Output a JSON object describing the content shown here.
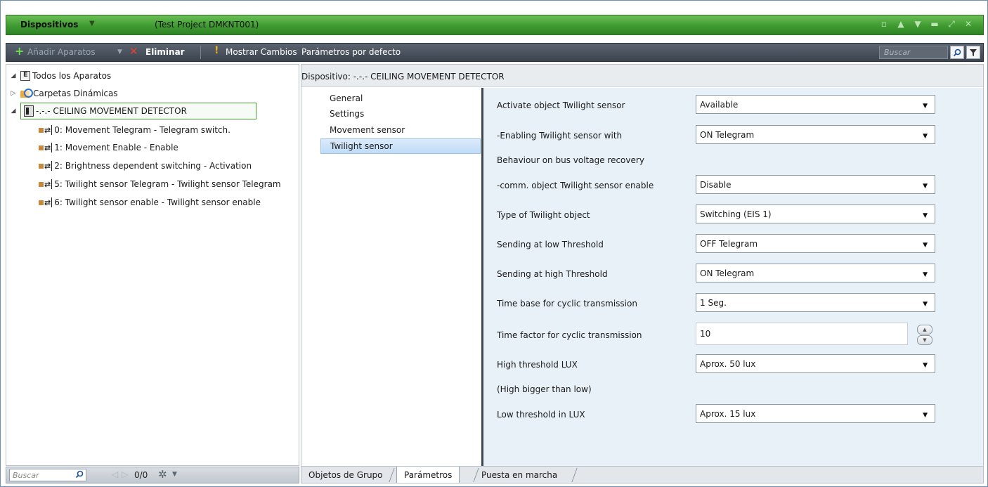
{
  "titlebar": {
    "title": "Dispositivos",
    "project": "(Test Project DMKNT001)",
    "icons": [
      "restore-icon",
      "up-icon",
      "down-icon",
      "maximize-icon",
      "expand-icon",
      "close-icon"
    ]
  },
  "toolbar": {
    "add_label": "Añadir Aparatos",
    "delete_label": "Eliminar",
    "show_changes_label": "Mostrar Cambios",
    "defaults_label": "Parámetros por defecto",
    "search_placeholder": "Buscar"
  },
  "tree": {
    "root": "Todos los Aparatos",
    "dynamic_folders": "Carpetas Dinámicas",
    "device": "-.-.-  CEILING MOVEMENT DETECTOR",
    "objects": [
      "0: Movement Telegram - Telegram switch.",
      "1: Movement Enable - Enable",
      "2: Brightness dependent switching - Activation",
      "5: Twilight sensor Telegram - Twilight sensor Telegram",
      "6: Twilight sensor enable - Twilight sensor enable"
    ]
  },
  "left_bottom": {
    "search_placeholder": "Buscar",
    "count": "0/0"
  },
  "device_header": "Dispositivo: -.-.-  CEILING MOVEMENT DETECTOR",
  "nav": {
    "items": [
      "General",
      "Settings",
      "Movement sensor",
      "Twilight sensor"
    ],
    "active": "Twilight sensor"
  },
  "params": [
    {
      "label": "Activate object Twilight sensor",
      "value": "Available",
      "type": "select"
    },
    {
      "label": "-Enabling Twilight sensor with",
      "value": "ON Telegram",
      "type": "select"
    },
    {
      "label": "Behaviour on bus voltage recovery",
      "value": "",
      "type": "text"
    },
    {
      "label": "-comm. object  Twilight sensor enable",
      "value": "Disable",
      "type": "select"
    },
    {
      "label": "Type of Twilight object",
      "value": "Switching (EIS 1)",
      "type": "select"
    },
    {
      "label": "Sending at low Threshold",
      "value": "OFF Telegram",
      "type": "select"
    },
    {
      "label": "Sending at high Threshold",
      "value": "ON Telegram",
      "type": "select"
    },
    {
      "label": "Time base for cyclic transmission",
      "value": "1 Seg.",
      "type": "select"
    },
    {
      "label": "Time factor for cyclic transmission",
      "value": "10",
      "type": "number"
    },
    {
      "label": "High threshold LUX",
      "value": "Aprox. 50 lux",
      "type": "select"
    },
    {
      "label": "(High bigger than low)",
      "value": "",
      "type": "text"
    },
    {
      "label": "Low threshold in LUX",
      "value": "Aprox. 15 lux",
      "type": "select"
    }
  ],
  "tabs": {
    "items": [
      "Objetos de Grupo",
      "Parámetros",
      "Puesta en marcha"
    ],
    "active": "Parámetros"
  },
  "colors": {
    "titlebar_green": "#3f9a31",
    "toolbar_dark": "#3b434d",
    "nav_active": "#c0dcf7",
    "params_bg": "#e9f1f8"
  }
}
